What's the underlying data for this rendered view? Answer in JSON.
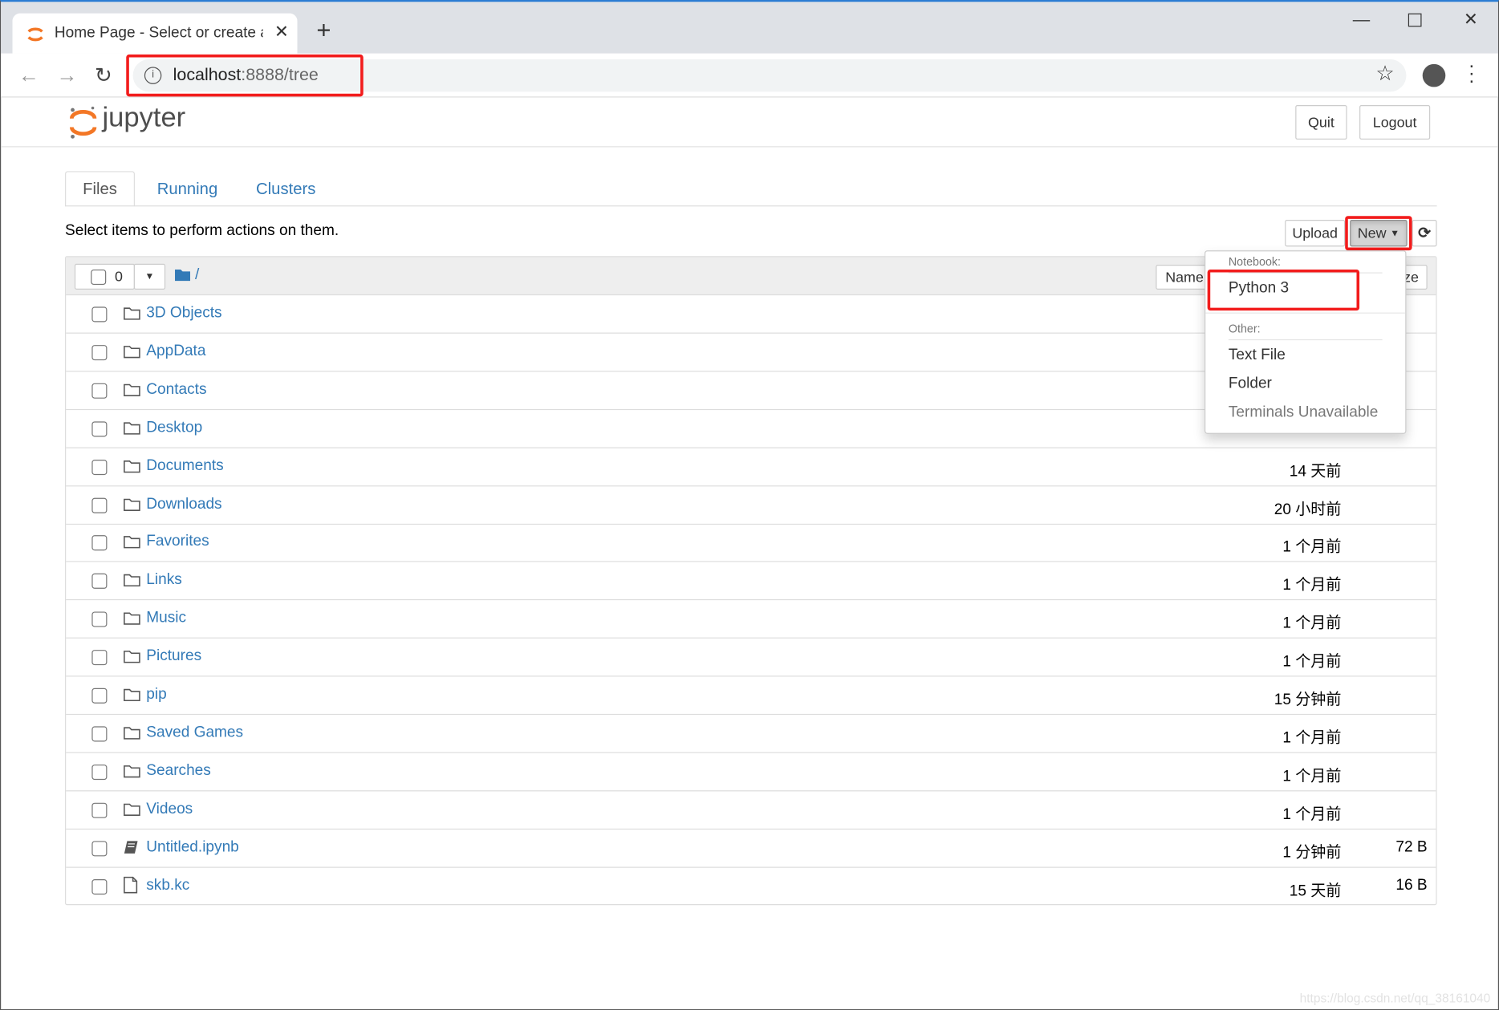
{
  "browser": {
    "tab_title": "Home Page - Select or create a notebook",
    "url_host": "localhost",
    "url_rest": ":8888/tree",
    "icons": [
      "back-icon",
      "forward-icon",
      "reload-icon",
      "info-icon",
      "star-icon",
      "profile-icon",
      "menu-icon"
    ]
  },
  "header": {
    "logo_text": "jupyter",
    "quit_label": "Quit",
    "logout_label": "Logout"
  },
  "tabs": [
    {
      "label": "Files"
    },
    {
      "label": "Running"
    },
    {
      "label": "Clusters"
    }
  ],
  "toolbar": {
    "hint": "Select items to perform actions on them.",
    "upload_label": "Upload",
    "new_label": "New"
  },
  "list_header": {
    "selected_count": "0",
    "path": "/",
    "sort_name": "Name",
    "size_tail": "ze"
  },
  "new_menu": {
    "notebook_label": "Notebook:",
    "python3": "Python 3",
    "other_label": "Other:",
    "text_file": "Text File",
    "folder": "Folder",
    "terminals": "Terminals Unavailable"
  },
  "files": [
    {
      "name": "3D Objects",
      "type": "folder",
      "modified": "",
      "size": ""
    },
    {
      "name": "AppData",
      "type": "folder",
      "modified": "",
      "size": ""
    },
    {
      "name": "Contacts",
      "type": "folder",
      "modified": "",
      "size": ""
    },
    {
      "name": "Desktop",
      "type": "folder",
      "modified": "",
      "size": ""
    },
    {
      "name": "Documents",
      "type": "folder",
      "modified": "14 天前",
      "size": ""
    },
    {
      "name": "Downloads",
      "type": "folder",
      "modified": "20 小时前",
      "size": ""
    },
    {
      "name": "Favorites",
      "type": "folder",
      "modified": "1 个月前",
      "size": ""
    },
    {
      "name": "Links",
      "type": "folder",
      "modified": "1 个月前",
      "size": ""
    },
    {
      "name": "Music",
      "type": "folder",
      "modified": "1 个月前",
      "size": ""
    },
    {
      "name": "Pictures",
      "type": "folder",
      "modified": "1 个月前",
      "size": ""
    },
    {
      "name": "pip",
      "type": "folder",
      "modified": "15 分钟前",
      "size": ""
    },
    {
      "name": "Saved Games",
      "type": "folder",
      "modified": "1 个月前",
      "size": ""
    },
    {
      "name": "Searches",
      "type": "folder",
      "modified": "1 个月前",
      "size": ""
    },
    {
      "name": "Videos",
      "type": "folder",
      "modified": "1 个月前",
      "size": ""
    },
    {
      "name": "Untitled.ipynb",
      "type": "notebook",
      "modified": "1 分钟前",
      "size": "72 B"
    },
    {
      "name": "skb.kc",
      "type": "file",
      "modified": "15 天前",
      "size": "16 B"
    }
  ],
  "watermark": "https://blog.csdn.net/qq_38161040",
  "colors": {
    "link": "#337ab7",
    "highlight": "#f21c1c",
    "jupyter_orange": "#f37726"
  }
}
